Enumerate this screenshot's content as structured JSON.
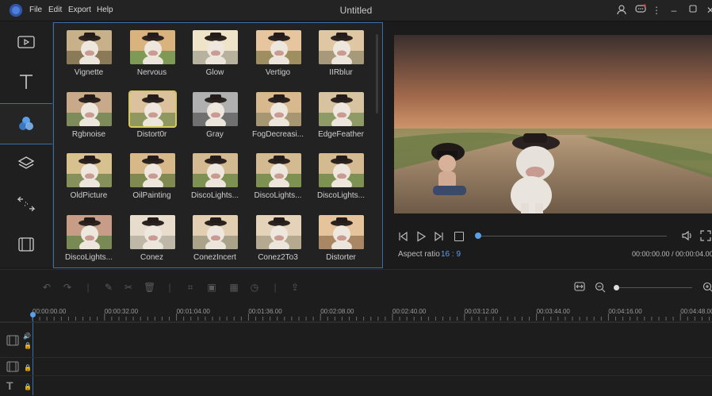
{
  "app": {
    "title": "Untitled"
  },
  "menu": [
    "File",
    "Edit",
    "Export",
    "Help"
  ],
  "colors": {
    "accent": "#3a6ea8",
    "selected": "#d6c85a",
    "bg": "#1b1b1b"
  },
  "sidebar": {
    "items": [
      {
        "icon": "media-icon"
      },
      {
        "icon": "text-icon"
      },
      {
        "icon": "filters-icon",
        "active": true
      },
      {
        "icon": "overlays-icon"
      },
      {
        "icon": "transitions-icon"
      },
      {
        "icon": "elements-icon"
      }
    ]
  },
  "filters": [
    {
      "label": "Vignette"
    },
    {
      "label": "Nervous"
    },
    {
      "label": "Glow"
    },
    {
      "label": "Vertigo"
    },
    {
      "label": "IIRblur"
    },
    {
      "label": "Rgbnoise"
    },
    {
      "label": "Distort0r",
      "selected": true
    },
    {
      "label": "Gray"
    },
    {
      "label": "FogDecreasi..."
    },
    {
      "label": "EdgeFeather"
    },
    {
      "label": "OldPicture"
    },
    {
      "label": "OilPainting"
    },
    {
      "label": "DiscoLights..."
    },
    {
      "label": "DiscoLights..."
    },
    {
      "label": "DiscoLights..."
    },
    {
      "label": "DiscoLights..."
    },
    {
      "label": "Conez"
    },
    {
      "label": "ConezIncert"
    },
    {
      "label": "Conez2To3"
    },
    {
      "label": "Distorter"
    }
  ],
  "player": {
    "aspect_label": "Aspect ratio",
    "aspect_value": "16 : 9",
    "time": "00:00:00.00 / 00:00:04.00",
    "progress": 0
  },
  "timeline": {
    "ruler": [
      "00:00:00.00",
      "00:00:32.00",
      "00:01:04.00",
      "00:01:36.00",
      "00:02:08.00",
      "00:02:40.00",
      "00:03:12.00",
      "00:03:44.00",
      "00:04:16.00",
      "00:04:48.00"
    ]
  }
}
